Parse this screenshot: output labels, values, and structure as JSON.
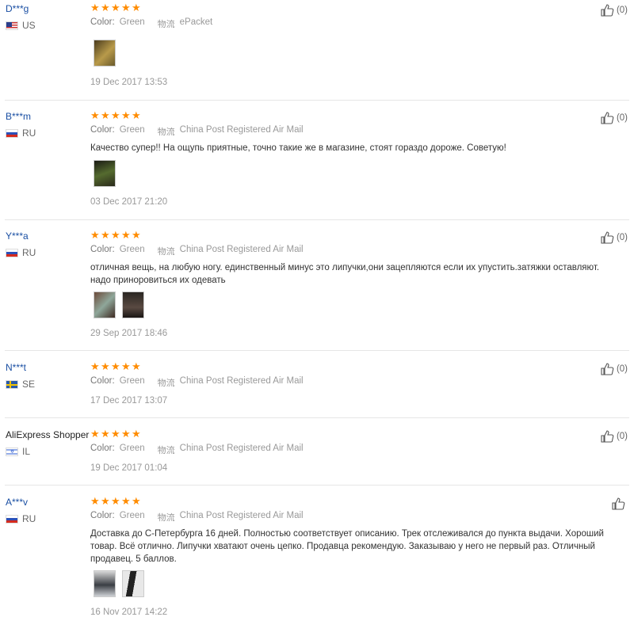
{
  "color_label": "Color:",
  "reviews": [
    {
      "user": "D***g",
      "country": "US",
      "color": "Green",
      "shipping_icon_text": "物流",
      "shipping": "ePacket",
      "text": "",
      "date": "19 Dec 2017 13:53",
      "likes": "(0)",
      "photos": 1
    },
    {
      "user": "B***m",
      "country": "RU",
      "color": "Green",
      "shipping_icon_text": "物流",
      "shipping": "China Post Registered Air Mail",
      "text": "Качество супер!! На ощупь приятные, точно такие же в магазине, стоят гораздо дороже. Советую!",
      "date": "03 Dec 2017 21:20",
      "likes": "(0)",
      "photos": 1
    },
    {
      "user": "Y***a",
      "country": "RU",
      "color": "Green",
      "shipping_icon_text": "物流",
      "shipping": "China Post Registered Air Mail",
      "text": "отличная вещь, на любую ногу. единственный минус это липучки,они зацепляются если их упустить.затяжки оставляют. надо приноровиться их одевать",
      "date": "29 Sep 2017 18:46",
      "likes": "(0)",
      "photos": 2
    },
    {
      "user": "N***t",
      "country": "SE",
      "color": "Green",
      "shipping_icon_text": "物流",
      "shipping": "China Post Registered Air Mail",
      "text": "",
      "date": "17 Dec 2017 13:07",
      "likes": "(0)",
      "photos": 0
    },
    {
      "user": "AliExpress Shopper",
      "country": "IL",
      "color": "Green",
      "shipping_icon_text": "物流",
      "shipping": "China Post Registered Air Mail",
      "text": "",
      "date": "19 Dec 2017 01:04",
      "likes": "(0)",
      "photos": 0
    },
    {
      "user": "A***v",
      "country": "RU",
      "color": "Green",
      "shipping_icon_text": "物流",
      "shipping": "China Post Registered Air Mail",
      "text": "Доставка до С-Петербурга 16 дней. Полностью соответствует описанию. Трек отслеживался до пункта выдачи. Хороший товар. Всё отлично. Липучки хватают очень цепко. Продавца рекомендую. Заказываю у него не первый раз. Отличный продавец. 5 баллов.",
      "date": "16 Nov 2017 14:22",
      "likes": "",
      "photos": 2
    }
  ]
}
